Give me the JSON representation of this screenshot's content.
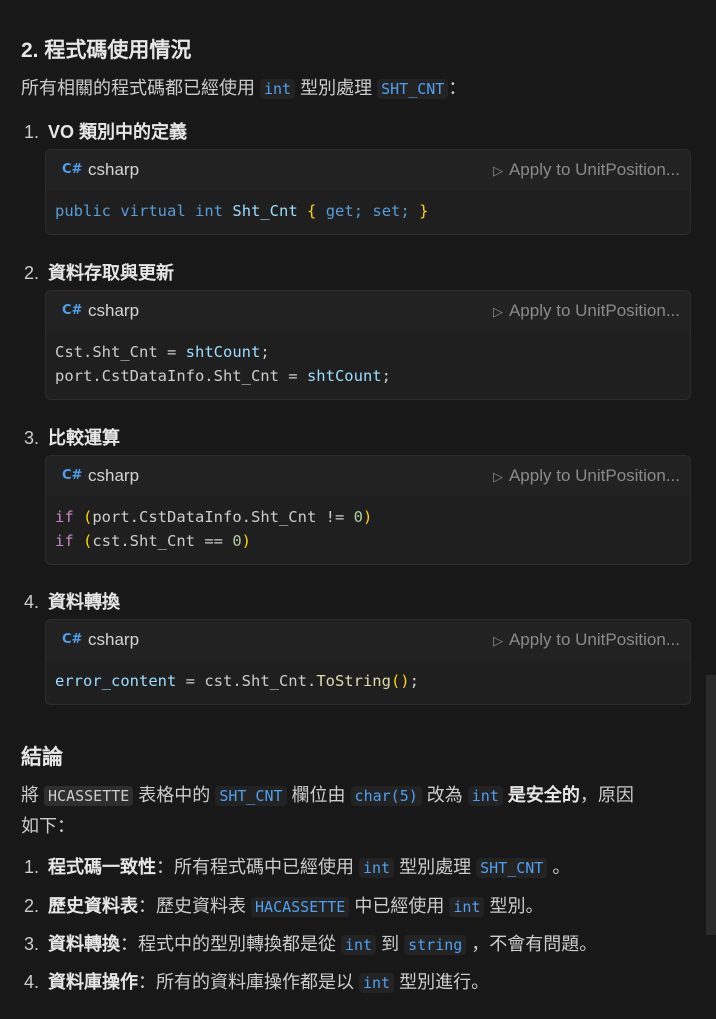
{
  "section_title": "2. 程式碼使用情況",
  "intro": {
    "before": "所有相關的程式碼都已經使用 ",
    "code1": "int",
    "middle": " 型別處理 ",
    "code2": "SHT_CNT",
    "after": "："
  },
  "items": [
    {
      "number": "1.",
      "title": "VO 類別中的定義"
    },
    {
      "number": "2.",
      "title": "資料存取與更新"
    },
    {
      "number": "3.",
      "title": "比較運算"
    },
    {
      "number": "4.",
      "title": "資料轉換"
    }
  ],
  "code_block": {
    "language": "csharp",
    "apply_label": "Apply to UnitPosition..."
  },
  "code": {
    "b1l1": [
      "public",
      "virtual",
      "int",
      "Sht_Cnt",
      "{",
      "get;",
      "set;",
      "}"
    ],
    "b2l1": [
      "Cst.Sht_Cnt",
      " = ",
      "shtCount",
      ";"
    ],
    "b2l2": [
      "port.CstDataInfo.Sht_Cnt",
      " = ",
      "shtCount",
      ";"
    ],
    "b3l1": [
      "if",
      " (",
      "port.CstDataInfo.Sht_Cnt != ",
      "0",
      ")"
    ],
    "b3l2": [
      "if",
      " (",
      "cst.Sht_Cnt == ",
      "0",
      ")"
    ],
    "b4l1": [
      "error_content",
      " = cst.Sht_Cnt.",
      "ToString",
      "()",
      ";"
    ]
  },
  "conclusion_title": "結論",
  "conclusion": {
    "p1": "將 ",
    "c1": "HCASSETTE",
    "p2": " 表格中的 ",
    "c2": "SHT_CNT",
    "p3": " 欄位由 ",
    "c3": "char(5)",
    "p4": " 改為 ",
    "c4": "int",
    "p5": " ",
    "bold": "是安全的",
    "p6": "，原因",
    "line2": "如下："
  },
  "reasons": [
    {
      "number": "1.",
      "title": "程式碼一致性",
      "text": "：所有程式碼中已經使用 ",
      "code": "int",
      "text2": " 型別處理 ",
      "code2": "SHT_CNT",
      "text3": " 。"
    },
    {
      "number": "2.",
      "title": "歷史資料表",
      "text": "：歷史資料表 ",
      "code": "HACASSETTE",
      "text2": " 中已經使用 ",
      "code2": "int",
      "text3": " 型別。"
    },
    {
      "number": "3.",
      "title": "資料轉換",
      "text": "：程式中的型別轉換都是從 ",
      "code": "int",
      "text2": " 到 ",
      "code2": "string",
      "text3": " ，不會有問題。"
    },
    {
      "number": "4.",
      "title": "資料庫操作",
      "text": "：所有的資料庫操作都是以 ",
      "code": "int",
      "text2": " 型別進行",
      "code2": "",
      "text3": "。"
    }
  ]
}
